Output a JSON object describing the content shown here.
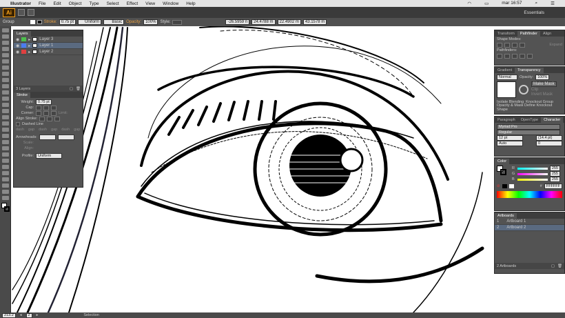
{
  "menubar": {
    "apple": "",
    "app": "Illustrator",
    "items": [
      "File",
      "Edit",
      "Object",
      "Type",
      "Select",
      "Effect",
      "View",
      "Window",
      "Help"
    ],
    "clock": "mar 16:57"
  },
  "appbar": {
    "logo": "Ai",
    "workspace": "Essentials"
  },
  "control": {
    "mode": "Group",
    "stroke_label": "Stroke:",
    "stroke_weight": "0.75 pt",
    "uniform": "Uniform",
    "basic": "Basic",
    "opacity_label": "Opacity:",
    "opacity": "100%",
    "style_label": "Style:",
    "x": "-26.5959 n",
    "y": "24.4788 m",
    "w": "22.4902 m",
    "h": "43.1578 m"
  },
  "layers": {
    "title": "Layers",
    "items": [
      {
        "name": "Layer 3"
      },
      {
        "name": "Layer 1"
      },
      {
        "name": "Layer 2"
      }
    ],
    "footer": "3 Layers"
  },
  "stroke": {
    "title": "Stroke",
    "weight_label": "Weight:",
    "weight": "0.75 pt",
    "cap_label": "Cap:",
    "corner_label": "Corner:",
    "limit_label": "Limit:",
    "align_label": "Align Stroke:",
    "dashed": "Dashed Line",
    "dash_labels": [
      "dash",
      "gap",
      "dash",
      "gap",
      "dash",
      "gap"
    ],
    "arrowheads": "Arrowheads:",
    "scale": "Scale:",
    "align": "Align:",
    "profile": "Profile:",
    "profile_val": "Uniform"
  },
  "pathfinder": {
    "tabs": [
      "Transform",
      "Pathfinder",
      "Align"
    ],
    "shape_modes": "Shape Modes:",
    "expand": "Expand",
    "pathfinders": "Pathfinders:"
  },
  "transparency": {
    "tabs": [
      "Gradient",
      "Transparency"
    ],
    "blend": "Normal",
    "opacity_label": "Opacity:",
    "opacity": "100%",
    "make_mask": "Make Mask",
    "clip": "Clip",
    "invert": "Invert Mask",
    "isolate": "Isolate Blending",
    "knockout": "Knockout Group",
    "opacity_mask": "Opacity & Mask Define Knockout Shape"
  },
  "character": {
    "tabs": [
      "Paragraph",
      "OpenType",
      "Character"
    ],
    "font": "Myriad Pro",
    "style": "Regular",
    "size": "12 pt",
    "leading": "(14.4 pt)",
    "kerning": "Auto",
    "tracking": "0"
  },
  "color": {
    "title": "Color",
    "r": "255",
    "g": "255",
    "b": "255",
    "hex": "FFFFFF"
  },
  "artboards": {
    "title": "Artboards",
    "items": [
      {
        "num": "1",
        "name": "Artboard 1"
      },
      {
        "num": "2",
        "name": "Artboard 2"
      }
    ],
    "footer": "2 Artboards"
  },
  "status": {
    "zoom": "213.2",
    "page": "2",
    "tool": "Selection"
  }
}
